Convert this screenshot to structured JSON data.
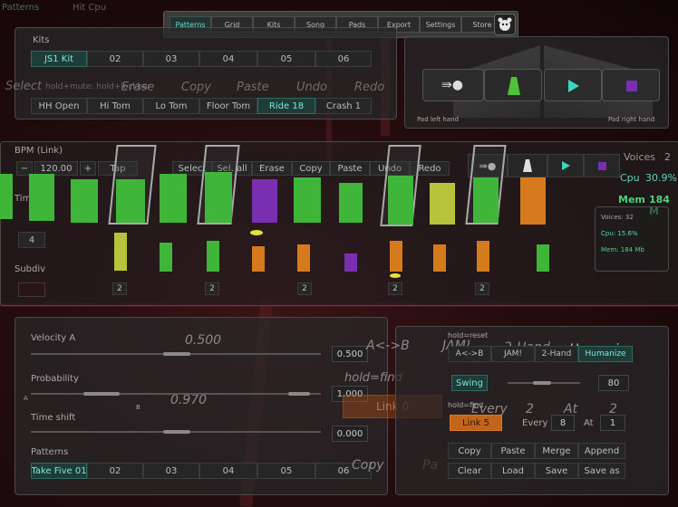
{
  "top_tabs_faded": [
    "Patterns",
    "Hit Cpu"
  ],
  "nav": {
    "items": [
      "Patterns",
      "Grid",
      "Kits",
      "Song",
      "Pads",
      "Export",
      "Settings",
      "Store"
    ],
    "selected": 0
  },
  "kits": {
    "label": "Kits",
    "items": [
      "JS1 Kit",
      "02",
      "03",
      "04",
      "05",
      "06"
    ],
    "selected": 0
  },
  "ghost_row": {
    "select": "Select",
    "hint": "hold+mute: hold+lockbar",
    "erase": "Erase",
    "copy": "Copy",
    "paste": "Paste",
    "undo": "Undo",
    "redo": "Redo"
  },
  "drums": {
    "items": [
      "HH Open",
      "Hi Tom",
      "Lo Tom",
      "Floor Tom",
      "Ride 18",
      "Crash 1"
    ],
    "selected": 4
  },
  "pads": {
    "left_label": "Pad left hand",
    "right_label": "Pad right hand"
  },
  "bpm": {
    "label": "BPM (Link)",
    "value": "120.00",
    "tap": "Tap",
    "minus": "−",
    "plus": "+"
  },
  "edit": {
    "items": [
      "Select",
      "Sel. all",
      "Erase",
      "Copy",
      "Paste",
      "Undo",
      "Redo"
    ]
  },
  "time_sig": {
    "label": "Time sig",
    "value": "4"
  },
  "subdiv": {
    "label": "Subdiv"
  },
  "step_labels": [
    "2",
    "2",
    "2",
    "2",
    "2"
  ],
  "stats": {
    "voices_label": "Voices",
    "voices_value": "2",
    "cpu_label": "Cpu",
    "cpu_value": "30.9%",
    "mem_label": "Mem",
    "mem_value": "184 M",
    "small_voices": "Voices: 32",
    "small_cpu": "Cpu: 15.6%",
    "small_mem": "Mem: 184 Mb"
  },
  "lower": {
    "velocity_label": "Velocity A",
    "velocity_value": "0.500",
    "velocity_box": "0.500",
    "probability_label": "Probability",
    "probability_value": "0.970",
    "probability_box": "1.000",
    "time_shift_label": "Time shift",
    "time_shift_box": "0.000",
    "a_mark": "A",
    "b_mark": "B",
    "hold_find": "hold=find",
    "link_ghost": "Link 0",
    "patterns_label": "Patterns",
    "patterns": [
      "Take Five 01",
      "02",
      "03",
      "04",
      "05",
      "06"
    ],
    "patterns_selected": 0,
    "copy_ghost": "Copy",
    "paste_ghost": "Paste",
    "paste_ghost2": "Pa"
  },
  "right_lower": {
    "hold_reset": "hold=reset",
    "modes_big": [
      "A<->B",
      "JAM!",
      "2-Hand",
      "Humanize"
    ],
    "modes": [
      "A<->B",
      "JAM!",
      "2-Hand",
      "Humanize"
    ],
    "swing": "Swing",
    "swing_value": "80",
    "hold_find": "hold=find",
    "every_big": "Every",
    "every_num": "2",
    "at_big": "At",
    "at_num": "2",
    "link": "Link 5",
    "every": "Every",
    "every_val": "8",
    "at": "At",
    "at_val": "1",
    "actions1": [
      "Copy",
      "Paste",
      "Merge",
      "Append"
    ],
    "actions2": [
      "Clear",
      "Load",
      "Save",
      "Save as"
    ]
  },
  "colors": {
    "green": "#3fb53a",
    "yellow": "#b8c23a",
    "orange": "#d67a1e",
    "purple": "#7a2fb0",
    "teal": "#3fd3c0"
  }
}
